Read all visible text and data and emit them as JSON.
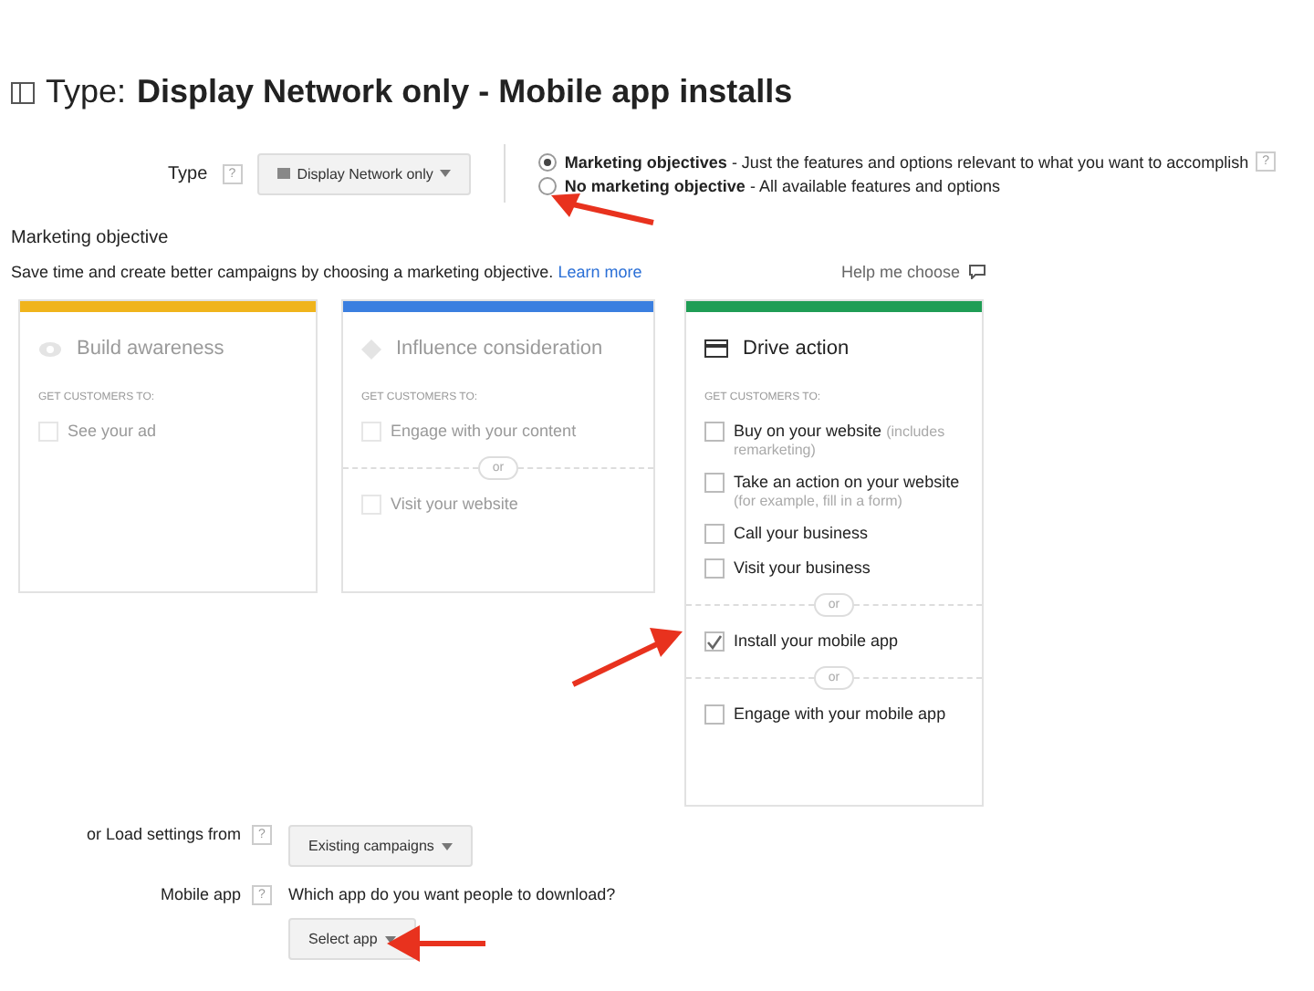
{
  "header": {
    "prefix": "Type:",
    "title": "Display Network only - Mobile app installs"
  },
  "type_row": {
    "label": "Type",
    "help": "?",
    "dropdown": "Display Network only",
    "options": [
      {
        "label": "Marketing objectives",
        "note": "- Just the features and options relevant to what you want to accomplish",
        "selected": true,
        "help": "?"
      },
      {
        "label": "No marketing objective",
        "note": "- All available features and options",
        "selected": false
      }
    ]
  },
  "objective": {
    "heading": "Marketing objective",
    "description": "Save time and create better campaigns by choosing a marketing objective.",
    "link": "Learn more",
    "help_link": "Help me choose"
  },
  "cards": [
    {
      "title": "Build awareness",
      "color": "#f0b41c",
      "disabled": true,
      "prompt": "GET CUSTOMERS TO:",
      "items": [
        {
          "kind": "option",
          "label": "See your ad",
          "checked": false
        }
      ]
    },
    {
      "title": "Influence consideration",
      "color": "#3b7fe0",
      "disabled": true,
      "prompt": "GET CUSTOMERS TO:",
      "items": [
        {
          "kind": "option",
          "label": "Engage with your content",
          "checked": false
        },
        {
          "kind": "or",
          "label": "or"
        },
        {
          "kind": "option",
          "label": "Visit your website",
          "checked": false
        }
      ]
    },
    {
      "title": "Drive action",
      "color": "#1f9d55",
      "disabled": false,
      "prompt": "GET CUSTOMERS TO:",
      "items": [
        {
          "kind": "option",
          "label": "Buy on your website",
          "note": "(includes remarketing)",
          "checked": false
        },
        {
          "kind": "option",
          "label": "Take an action on your website",
          "note": "(for example, fill in a form)",
          "checked": false
        },
        {
          "kind": "option",
          "label": "Call your business",
          "checked": false
        },
        {
          "kind": "option",
          "label": "Visit your business",
          "checked": false
        },
        {
          "kind": "or",
          "label": "or"
        },
        {
          "kind": "option",
          "label": "Install your mobile app",
          "checked": true
        },
        {
          "kind": "or",
          "label": "or"
        },
        {
          "kind": "option",
          "label": "Engage with your mobile app",
          "checked": false
        }
      ]
    }
  ],
  "load_settings": {
    "label": "or Load settings from",
    "help": "?",
    "dropdown": "Existing campaigns"
  },
  "mobile_app": {
    "label": "Mobile app",
    "help": "?",
    "question": "Which app do you want people to download?",
    "dropdown": "Select app"
  }
}
